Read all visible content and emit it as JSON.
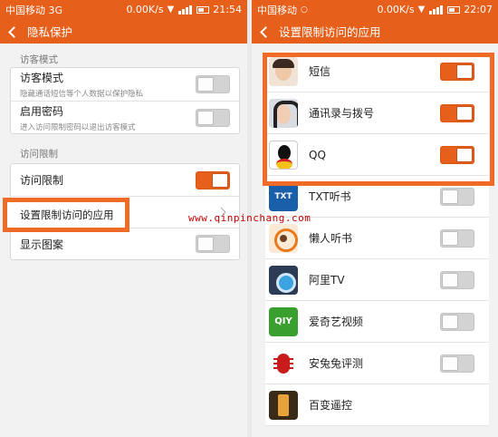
{
  "left": {
    "statusbar": {
      "carrier": "中国移动 3G",
      "speed": "0.00K/s",
      "time": "21:54"
    },
    "title": "隐私保护",
    "section_guest": "访客模式",
    "guest_mode": {
      "label": "访客模式",
      "desc": "隐藏通话短信等个人数据以保护隐私",
      "enabled": false
    },
    "password": {
      "label": "启用密码",
      "desc": "进入访问限制密码以退出访客模式",
      "enabled": false
    },
    "section_restrict": "访问限制",
    "restrict": {
      "label": "访问限制",
      "enabled": true
    },
    "set_apps": {
      "label": "设置限制访问的应用"
    },
    "show_pattern": {
      "label": "显示图案",
      "enabled": false
    }
  },
  "right": {
    "statusbar": {
      "carrier": "中国移动",
      "speed": "0.00K/s",
      "time": "22:07"
    },
    "title": "设置限制访问的应用",
    "apps": [
      {
        "name": "短信",
        "icon": "sms-avatar-icon",
        "enabled": true
      },
      {
        "name": "通讯录与拨号",
        "icon": "contacts-avatar-icon",
        "enabled": true
      },
      {
        "name": "QQ",
        "icon": "qq-penguin-icon",
        "enabled": true
      },
      {
        "name": "TXT听书",
        "icon": "txt-book-icon",
        "enabled": false
      },
      {
        "name": "懒人听书",
        "icon": "headphones-icon",
        "enabled": false
      },
      {
        "name": "阿里TV",
        "icon": "ali-tv-icon",
        "enabled": false
      },
      {
        "name": "爱奇艺视频",
        "icon": "iqiyi-icon",
        "enabled": false
      },
      {
        "name": "安兔兔评测",
        "icon": "antutu-icon",
        "enabled": false
      },
      {
        "name": "百变遥控",
        "icon": "remote-icon",
        "enabled": false
      }
    ]
  },
  "icon_text": {
    "txt": "TXT",
    "iqiyi": "QIY"
  },
  "watermark": "www.qinpinchang.com",
  "colors": {
    "accent": "#e65f1b",
    "highlight": "#f06a28",
    "switch_off": "#d3d3d3"
  }
}
